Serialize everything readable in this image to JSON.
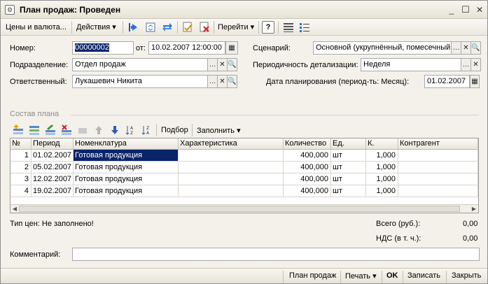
{
  "window": {
    "title": "План продаж: Проведен"
  },
  "toolbar": {
    "prices_label": "Цены и валюта...",
    "actions_label": "Действия",
    "goto_label": "Перейти",
    "help_label": "?"
  },
  "form": {
    "number_label": "Номер:",
    "number_value": "00000002",
    "date_label": "от:",
    "date_value": "10.02.2007 12:00:00",
    "scenario_label": "Сценарий:",
    "scenario_value": "Основной (укрупнённый, помесечный",
    "division_label": "Подразделение:",
    "division_value": "Отдел продаж",
    "periodicity_label": "Периодичность детализации:",
    "periodicity_value": "Неделя",
    "responsible_label": "Ответственный:",
    "responsible_value": "Лукашевич Никита",
    "planning_date_label": "Дата планирования (период-ть: Месяц):",
    "planning_date_value": "01.02.2007"
  },
  "plan": {
    "section_title": "Состав плана",
    "selection_label": "Подбор",
    "fill_label": "Заполнить",
    "columns": [
      "№",
      "Период",
      "Номенклатура",
      "Характеристика",
      "Количество",
      "Ед.",
      "К.",
      "Контрагент"
    ],
    "rows": [
      {
        "n": "1",
        "period": "01.02.2007",
        "item": "Готовая продукция",
        "characteristic": "",
        "qty": "400,000",
        "unit": "шт",
        "k": "1,000",
        "contractor": ""
      },
      {
        "n": "2",
        "period": "05.02.2007",
        "item": "Готовая продукция",
        "characteristic": "",
        "qty": "400,000",
        "unit": "шт",
        "k": "1,000",
        "contractor": ""
      },
      {
        "n": "3",
        "period": "12.02.2007",
        "item": "Готовая продукция",
        "characteristic": "",
        "qty": "400,000",
        "unit": "шт",
        "k": "1,000",
        "contractor": ""
      },
      {
        "n": "4",
        "period": "19.02.2007",
        "item": "Готовая продукция",
        "characteristic": "",
        "qty": "400,000",
        "unit": "шт",
        "k": "1,000",
        "contractor": ""
      }
    ]
  },
  "summary": {
    "price_type": "Тип цен: Не заполнено!",
    "total_label": "Всего (руб.):",
    "total_value": "0,00",
    "vat_label": "НДС (в т. ч.):",
    "vat_value": "0,00"
  },
  "comment": {
    "label": "Комментарий:",
    "value": ""
  },
  "footer": {
    "sales_plan_label": "План продаж",
    "print_label": "Печать",
    "ok_label": "OK",
    "save_label": "Записать",
    "close_label": "Закрыть"
  },
  "colors": {
    "selection": "#0a246a",
    "window_bg": "#f3f1ea"
  }
}
